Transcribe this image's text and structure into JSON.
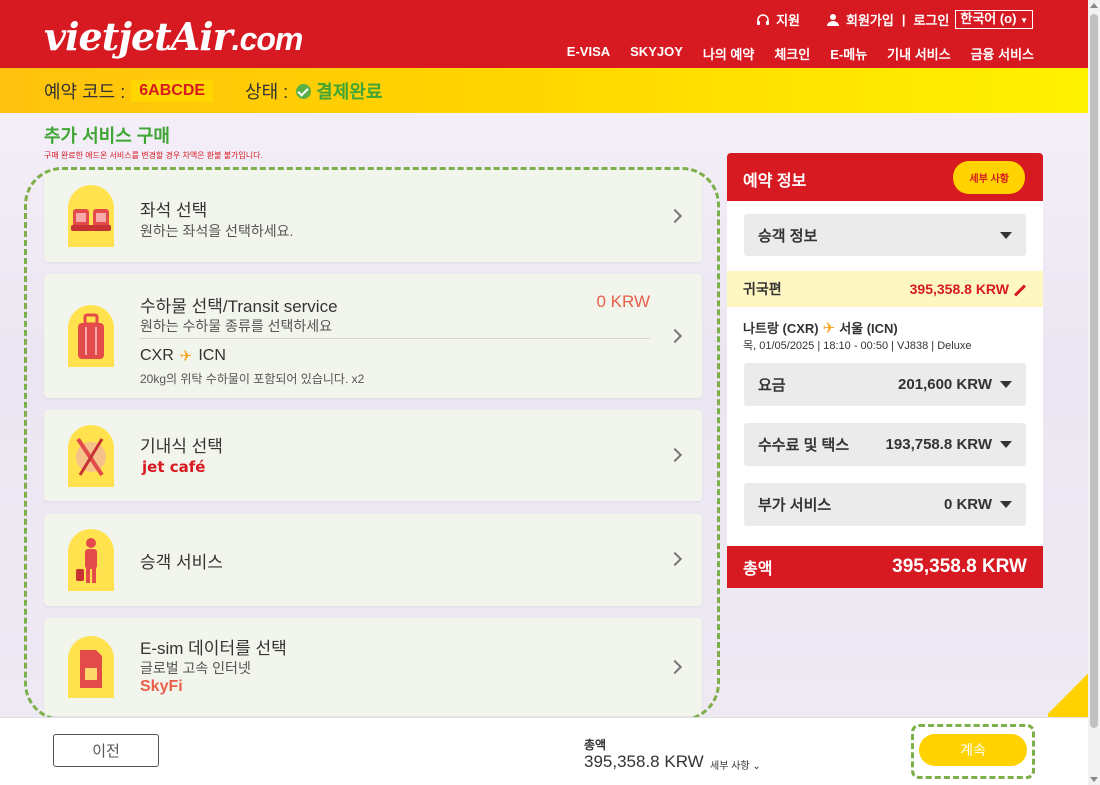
{
  "header": {
    "logo_main": "vietjetAir",
    "logo_dot": ".com",
    "util": {
      "support": "지원",
      "signup": "회원가입",
      "sep": "|",
      "login": "로그인",
      "lang": "한국어 (o)"
    },
    "nav": [
      "E-VISA",
      "SKYJOY",
      "나의 예약",
      "체크인",
      "E-메뉴",
      "기내 서비스",
      "금융 서비스"
    ]
  },
  "booking": {
    "code_label": "예약 코드 :",
    "code": "6ABCDE",
    "status_label": "상태 :",
    "status": "결제완료"
  },
  "section": {
    "title": "추가 서비스 구매",
    "note": "구매 완료한 애드온 서비스를 변경할 경우 차액은 환불 불가입니다."
  },
  "cards": {
    "seat": {
      "title": "좌석 선택",
      "sub": "원하는 좌석을 선택하세요."
    },
    "baggage": {
      "title": "수하물 선택/Transit service",
      "sub": "원하는 수하물 종류를 선택하세요",
      "price": "0 KRW",
      "from": "CXR",
      "to": "ICN",
      "note": "20kg의 위탁 수하물이 포함되어 있습니다. x2"
    },
    "meal": {
      "title": "기내식 선택",
      "brand": "jet café"
    },
    "passenger": {
      "title": "승객 서비스"
    },
    "esim": {
      "title": "E-sim 데이터를 선택",
      "sub": "글로벌 고속 인터넷",
      "brand": "SkyFi"
    }
  },
  "panel": {
    "title": "예약 정보",
    "detail_btn": "세부 사항",
    "passenger_info": "승객 정보",
    "flight_label": "귀국편",
    "flight_amount": "395,358.8 KRW",
    "route_from": "나트랑 (CXR)",
    "route_to": "서울 (ICN)",
    "flight_info": "목, 01/05/2025 | 18:10 - 00:50 | VJ838 | Deluxe",
    "fare_label": "요금",
    "fare_value": "201,600 KRW",
    "tax_label": "수수료 및 택스",
    "tax_value": "193,758.8 KRW",
    "addon_label": "부가 서비스",
    "addon_value": "0 KRW",
    "total_label": "총액",
    "total_value": "395,358.8 KRW"
  },
  "footer": {
    "prev": "이전",
    "total_label": "총액",
    "total_value": "395,358.8 KRW",
    "detail": "세부 사항",
    "continue": "계속"
  },
  "colors": {
    "brand_red": "#d71921",
    "brand_yellow": "#ffd200",
    "green": "#3fa535"
  }
}
